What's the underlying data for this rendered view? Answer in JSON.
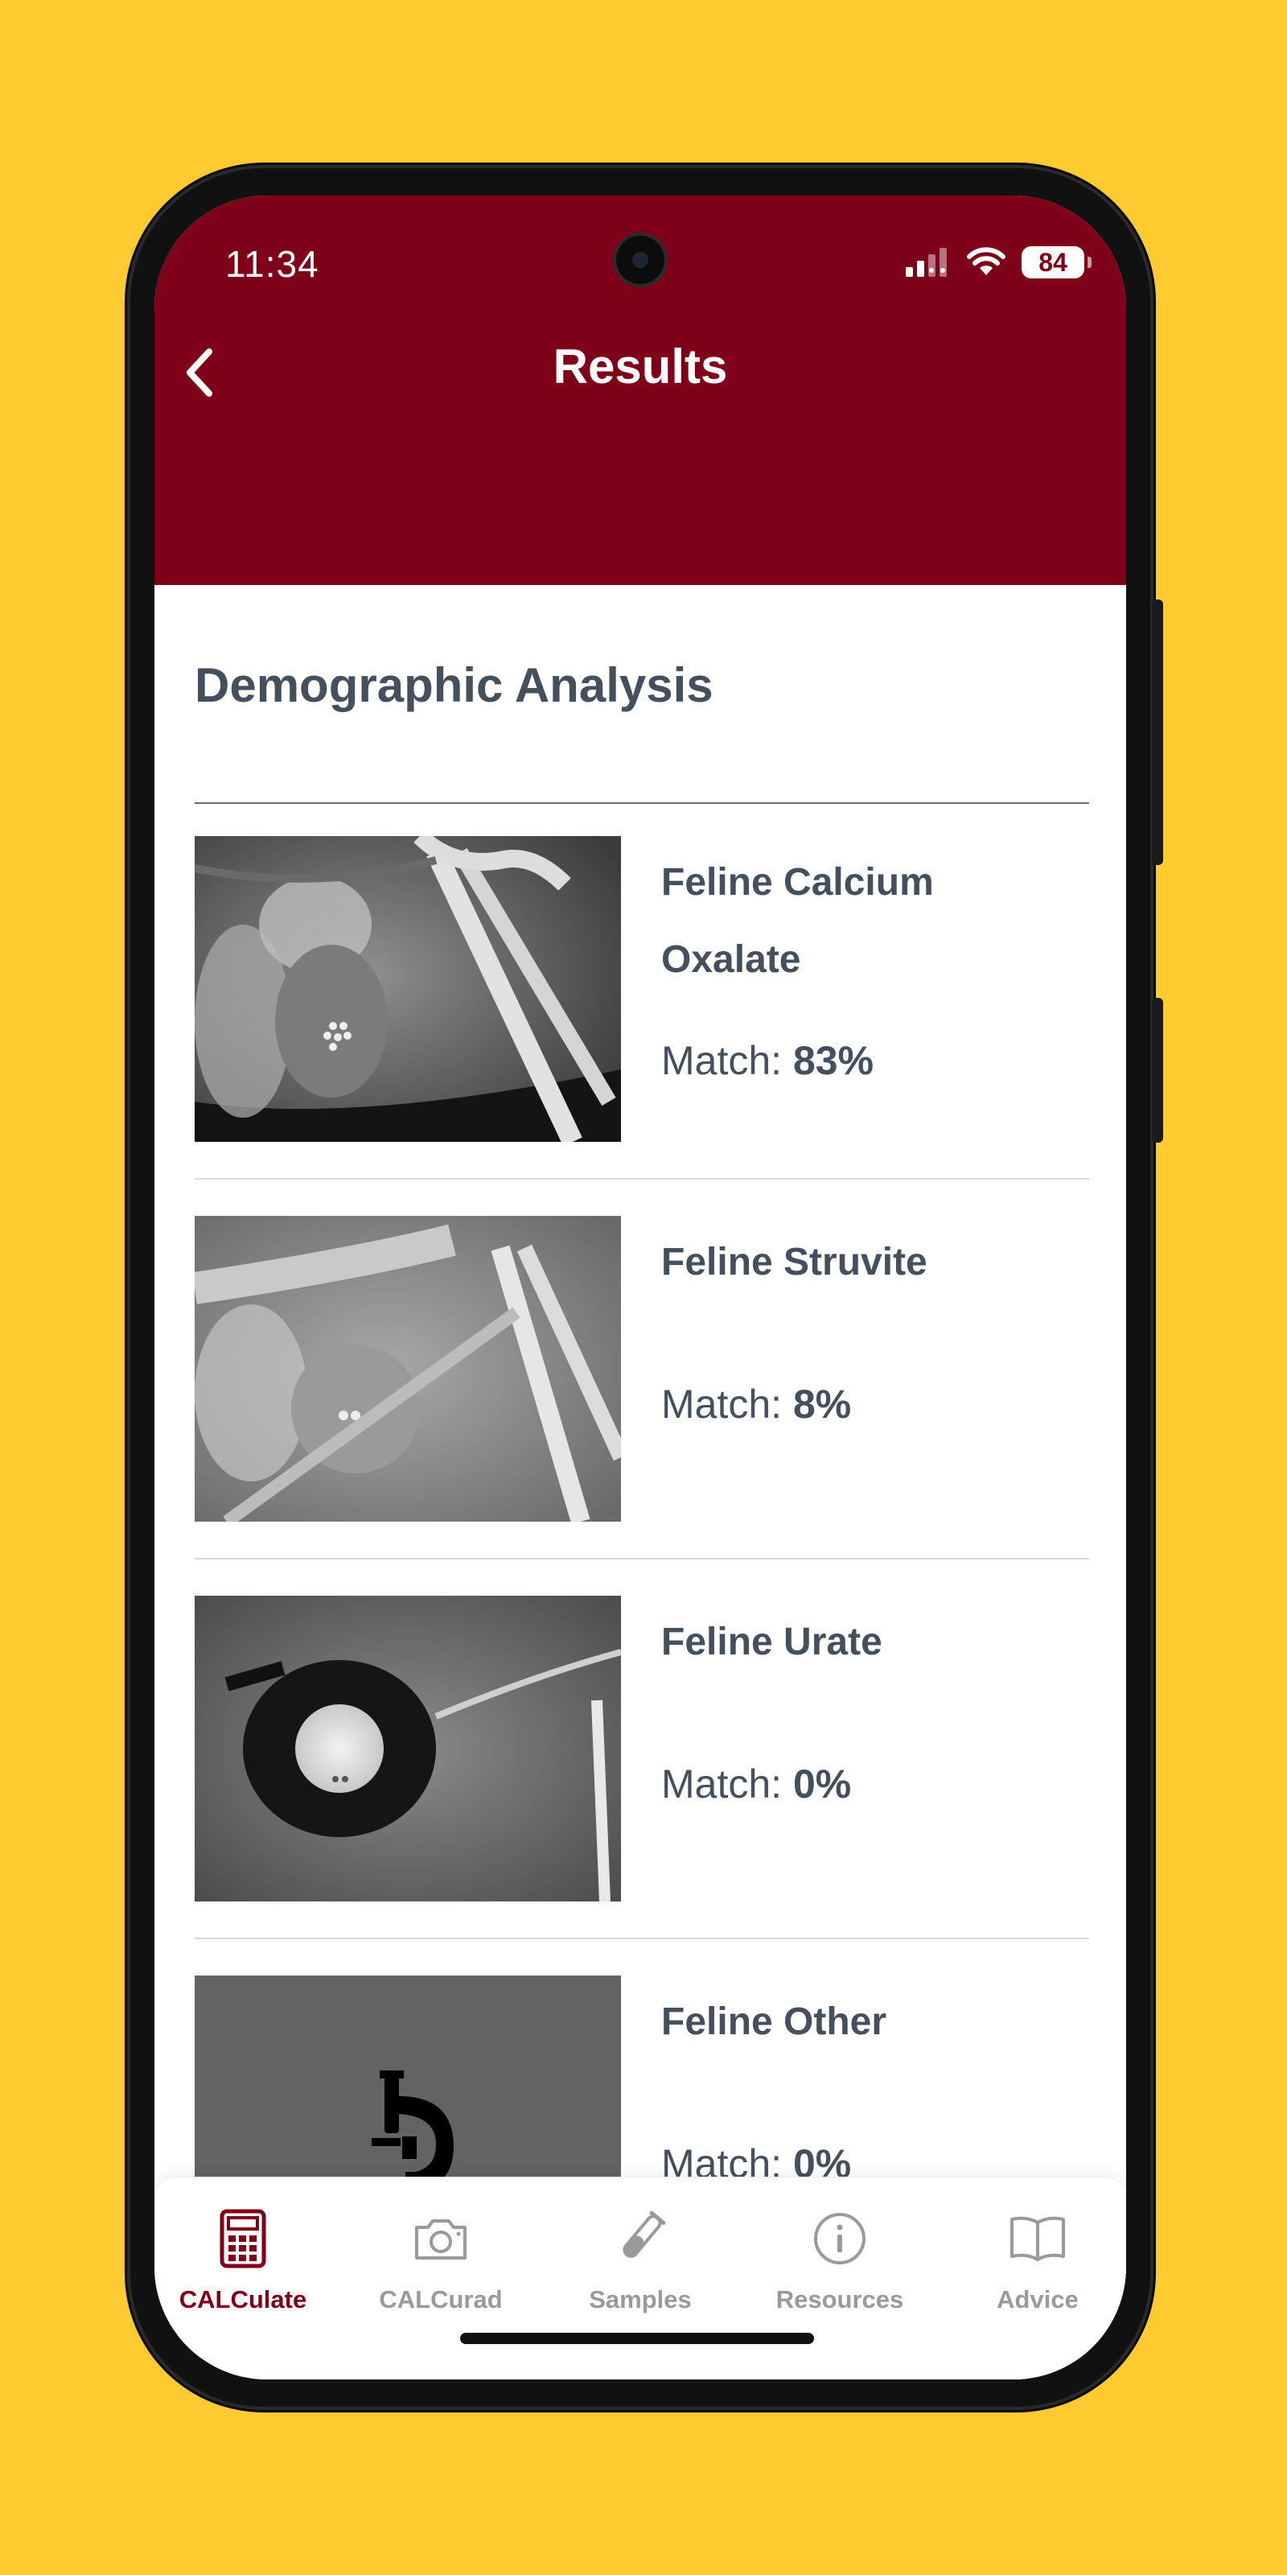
{
  "status_bar": {
    "time": "11:34",
    "battery": "84"
  },
  "header": {
    "title": "Results"
  },
  "section": {
    "title": "Demographic Analysis"
  },
  "match_label": "Match:",
  "results": [
    {
      "name": "Feline Calcium Oxalate",
      "match": "83%"
    },
    {
      "name": "Feline Struvite",
      "match": "8%"
    },
    {
      "name": "Feline Urate",
      "match": "0%"
    },
    {
      "name": "Feline Other",
      "match": "0%"
    }
  ],
  "tabs": [
    {
      "label": "CALCulate",
      "icon": "calculator-icon",
      "active": true
    },
    {
      "label": "CALCurad",
      "icon": "camera-icon",
      "active": false
    },
    {
      "label": "Samples",
      "icon": "test-tube-icon",
      "active": false
    },
    {
      "label": "Resources",
      "icon": "info-icon",
      "active": false
    },
    {
      "label": "Advice",
      "icon": "book-icon",
      "active": false
    }
  ],
  "colors": {
    "brand": "#7F0019",
    "background": "#FFCB30",
    "text": "#44505E",
    "inactive": "#9A9A9A"
  }
}
